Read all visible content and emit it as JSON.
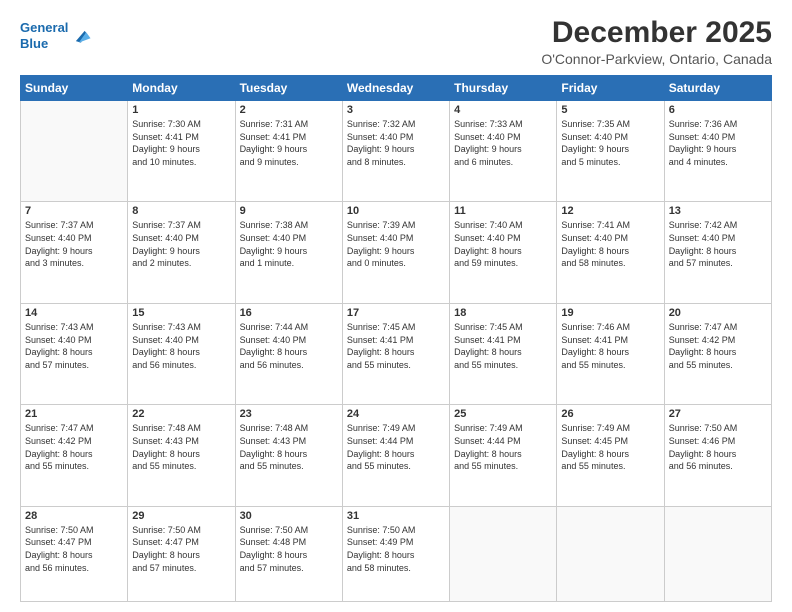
{
  "logo": {
    "line1": "General",
    "line2": "Blue"
  },
  "title": "December 2025",
  "location": "O'Connor-Parkview, Ontario, Canada",
  "days_header": [
    "Sunday",
    "Monday",
    "Tuesday",
    "Wednesday",
    "Thursday",
    "Friday",
    "Saturday"
  ],
  "weeks": [
    [
      {
        "day": "",
        "info": ""
      },
      {
        "day": "1",
        "info": "Sunrise: 7:30 AM\nSunset: 4:41 PM\nDaylight: 9 hours\nand 10 minutes."
      },
      {
        "day": "2",
        "info": "Sunrise: 7:31 AM\nSunset: 4:41 PM\nDaylight: 9 hours\nand 9 minutes."
      },
      {
        "day": "3",
        "info": "Sunrise: 7:32 AM\nSunset: 4:40 PM\nDaylight: 9 hours\nand 8 minutes."
      },
      {
        "day": "4",
        "info": "Sunrise: 7:33 AM\nSunset: 4:40 PM\nDaylight: 9 hours\nand 6 minutes."
      },
      {
        "day": "5",
        "info": "Sunrise: 7:35 AM\nSunset: 4:40 PM\nDaylight: 9 hours\nand 5 minutes."
      },
      {
        "day": "6",
        "info": "Sunrise: 7:36 AM\nSunset: 4:40 PM\nDaylight: 9 hours\nand 4 minutes."
      }
    ],
    [
      {
        "day": "7",
        "info": "Sunrise: 7:37 AM\nSunset: 4:40 PM\nDaylight: 9 hours\nand 3 minutes."
      },
      {
        "day": "8",
        "info": "Sunrise: 7:37 AM\nSunset: 4:40 PM\nDaylight: 9 hours\nand 2 minutes."
      },
      {
        "day": "9",
        "info": "Sunrise: 7:38 AM\nSunset: 4:40 PM\nDaylight: 9 hours\nand 1 minute."
      },
      {
        "day": "10",
        "info": "Sunrise: 7:39 AM\nSunset: 4:40 PM\nDaylight: 9 hours\nand 0 minutes."
      },
      {
        "day": "11",
        "info": "Sunrise: 7:40 AM\nSunset: 4:40 PM\nDaylight: 8 hours\nand 59 minutes."
      },
      {
        "day": "12",
        "info": "Sunrise: 7:41 AM\nSunset: 4:40 PM\nDaylight: 8 hours\nand 58 minutes."
      },
      {
        "day": "13",
        "info": "Sunrise: 7:42 AM\nSunset: 4:40 PM\nDaylight: 8 hours\nand 57 minutes."
      }
    ],
    [
      {
        "day": "14",
        "info": "Sunrise: 7:43 AM\nSunset: 4:40 PM\nDaylight: 8 hours\nand 57 minutes."
      },
      {
        "day": "15",
        "info": "Sunrise: 7:43 AM\nSunset: 4:40 PM\nDaylight: 8 hours\nand 56 minutes."
      },
      {
        "day": "16",
        "info": "Sunrise: 7:44 AM\nSunset: 4:40 PM\nDaylight: 8 hours\nand 56 minutes."
      },
      {
        "day": "17",
        "info": "Sunrise: 7:45 AM\nSunset: 4:41 PM\nDaylight: 8 hours\nand 55 minutes."
      },
      {
        "day": "18",
        "info": "Sunrise: 7:45 AM\nSunset: 4:41 PM\nDaylight: 8 hours\nand 55 minutes."
      },
      {
        "day": "19",
        "info": "Sunrise: 7:46 AM\nSunset: 4:41 PM\nDaylight: 8 hours\nand 55 minutes."
      },
      {
        "day": "20",
        "info": "Sunrise: 7:47 AM\nSunset: 4:42 PM\nDaylight: 8 hours\nand 55 minutes."
      }
    ],
    [
      {
        "day": "21",
        "info": "Sunrise: 7:47 AM\nSunset: 4:42 PM\nDaylight: 8 hours\nand 55 minutes."
      },
      {
        "day": "22",
        "info": "Sunrise: 7:48 AM\nSunset: 4:43 PM\nDaylight: 8 hours\nand 55 minutes."
      },
      {
        "day": "23",
        "info": "Sunrise: 7:48 AM\nSunset: 4:43 PM\nDaylight: 8 hours\nand 55 minutes."
      },
      {
        "day": "24",
        "info": "Sunrise: 7:49 AM\nSunset: 4:44 PM\nDaylight: 8 hours\nand 55 minutes."
      },
      {
        "day": "25",
        "info": "Sunrise: 7:49 AM\nSunset: 4:44 PM\nDaylight: 8 hours\nand 55 minutes."
      },
      {
        "day": "26",
        "info": "Sunrise: 7:49 AM\nSunset: 4:45 PM\nDaylight: 8 hours\nand 55 minutes."
      },
      {
        "day": "27",
        "info": "Sunrise: 7:50 AM\nSunset: 4:46 PM\nDaylight: 8 hours\nand 56 minutes."
      }
    ],
    [
      {
        "day": "28",
        "info": "Sunrise: 7:50 AM\nSunset: 4:47 PM\nDaylight: 8 hours\nand 56 minutes."
      },
      {
        "day": "29",
        "info": "Sunrise: 7:50 AM\nSunset: 4:47 PM\nDaylight: 8 hours\nand 57 minutes."
      },
      {
        "day": "30",
        "info": "Sunrise: 7:50 AM\nSunset: 4:48 PM\nDaylight: 8 hours\nand 57 minutes."
      },
      {
        "day": "31",
        "info": "Sunrise: 7:50 AM\nSunset: 4:49 PM\nDaylight: 8 hours\nand 58 minutes."
      },
      {
        "day": "",
        "info": ""
      },
      {
        "day": "",
        "info": ""
      },
      {
        "day": "",
        "info": ""
      }
    ]
  ]
}
